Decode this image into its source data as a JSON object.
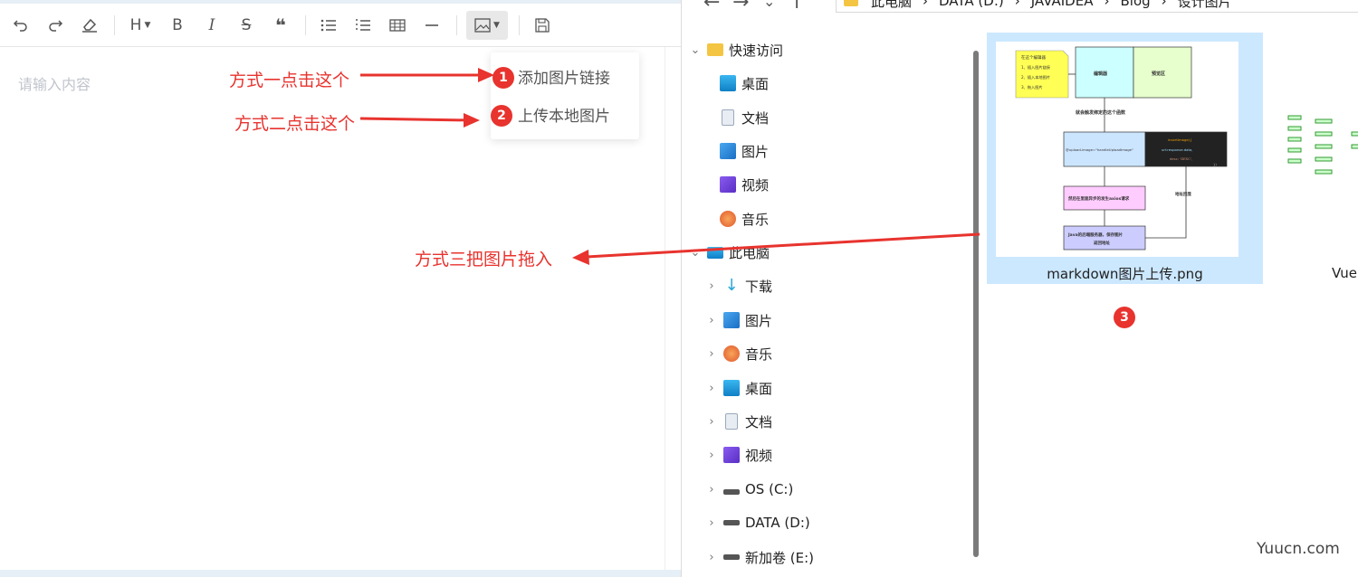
{
  "editor": {
    "placeholder": "请输入内容",
    "toolbar": [
      "undo",
      "redo",
      "eraser",
      "H",
      "B",
      "I",
      "S",
      "quote",
      "unordered-list",
      "ordered-list",
      "table",
      "horizontal-rule",
      "image",
      "save"
    ],
    "heading_label": "H",
    "bold_label": "B",
    "italic_label": "I",
    "strike_label": "S",
    "quote_label": "❝",
    "image_menu": {
      "item1": "添加图片链接",
      "item2": "上传本地图片"
    }
  },
  "annotations": {
    "method1": "方式一点击这个",
    "method2": "方式二点击这个",
    "method3": "方式三把图片拖入",
    "badge1": "1",
    "badge2": "2",
    "badge3": "3",
    "color": "#e8332e"
  },
  "explorer": {
    "breadcrumb": [
      "此电脑",
      "DATA (D:)",
      "JAVAIDEA",
      "Blog",
      "设计图片"
    ],
    "quick_access": "快速访问",
    "quick_items": [
      "桌面",
      "文档",
      "图片",
      "视频",
      "音乐"
    ],
    "this_pc": "此电脑",
    "pc_items": [
      "下载",
      "图片",
      "音乐",
      "桌面",
      "文档",
      "视频",
      "OS (C:)",
      "DATA (D:)",
      "新加卷 (E:)"
    ],
    "file1": "markdown图片上传.png",
    "file2": "Vue",
    "thumb_text": {
      "note_title": "在这个编辑器",
      "note1": "1、插入图片链接",
      "note2": "2、插入本地图片",
      "note3": "3、拖入图片",
      "box_editor": "编辑器",
      "box_preview": "预览区",
      "trigger": "就会触发绑定的这个函数",
      "code_left": "@upload-image=\"handleUploadImage\"",
      "code1": "insertImage({",
      "code2": "url:response.data,",
      "code3": "desc: 'DESC',",
      "code4": "})",
      "step_axios": "然后在里面异步的发生axios请求",
      "step_java": "Java的后端服务器，保存图片",
      "step_java2": "返回地址",
      "return_addr": "地址回显"
    }
  },
  "watermark": "Yuucn.com"
}
